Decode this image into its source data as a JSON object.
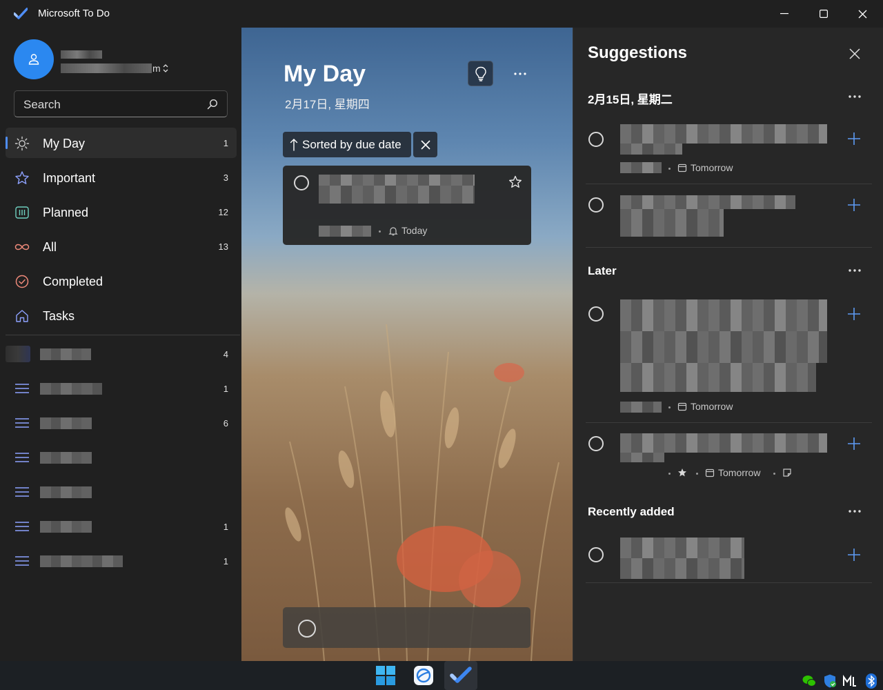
{
  "window": {
    "title": "Microsoft To Do"
  },
  "account": {
    "name_tail": "m"
  },
  "search": {
    "placeholder": "Search"
  },
  "sidebar": {
    "nav": [
      {
        "label": "My Day",
        "count": "1",
        "icon": "sun-icon",
        "active": true
      },
      {
        "label": "Important",
        "count": "3",
        "icon": "star-icon"
      },
      {
        "label": "Planned",
        "count": "12",
        "icon": "calendar-grid-icon"
      },
      {
        "label": "All",
        "count": "13",
        "icon": "infinity-icon"
      },
      {
        "label": "Completed",
        "count": "",
        "icon": "check-circle-icon"
      },
      {
        "label": "Tasks",
        "count": "",
        "icon": "home-icon"
      }
    ],
    "lists": [
      {
        "count": "4"
      },
      {
        "count": "1"
      },
      {
        "count": "6"
      },
      {
        "count": ""
      },
      {
        "count": ""
      },
      {
        "count": "1"
      },
      {
        "count": "1"
      }
    ]
  },
  "main": {
    "title": "My Day",
    "date": "2月17日, 星期四",
    "sort_label": "Sorted by due date",
    "task": {
      "due": "Today"
    }
  },
  "suggestions": {
    "title": "Suggestions",
    "sections": [
      {
        "title": "2月15日, 星期二"
      },
      {
        "title": "Later"
      },
      {
        "title": "Recently added"
      }
    ],
    "items": [
      {
        "due": "Tomorrow"
      },
      {
        "due": ""
      },
      {
        "due": "Tomorrow"
      },
      {
        "due": "Tomorrow"
      },
      {
        "due": ""
      }
    ]
  },
  "colors": {
    "accent": "#4f8ef7",
    "avatar": "#2b88f0",
    "panel_bg": "#272727",
    "sidebar_bg": "#202020"
  }
}
